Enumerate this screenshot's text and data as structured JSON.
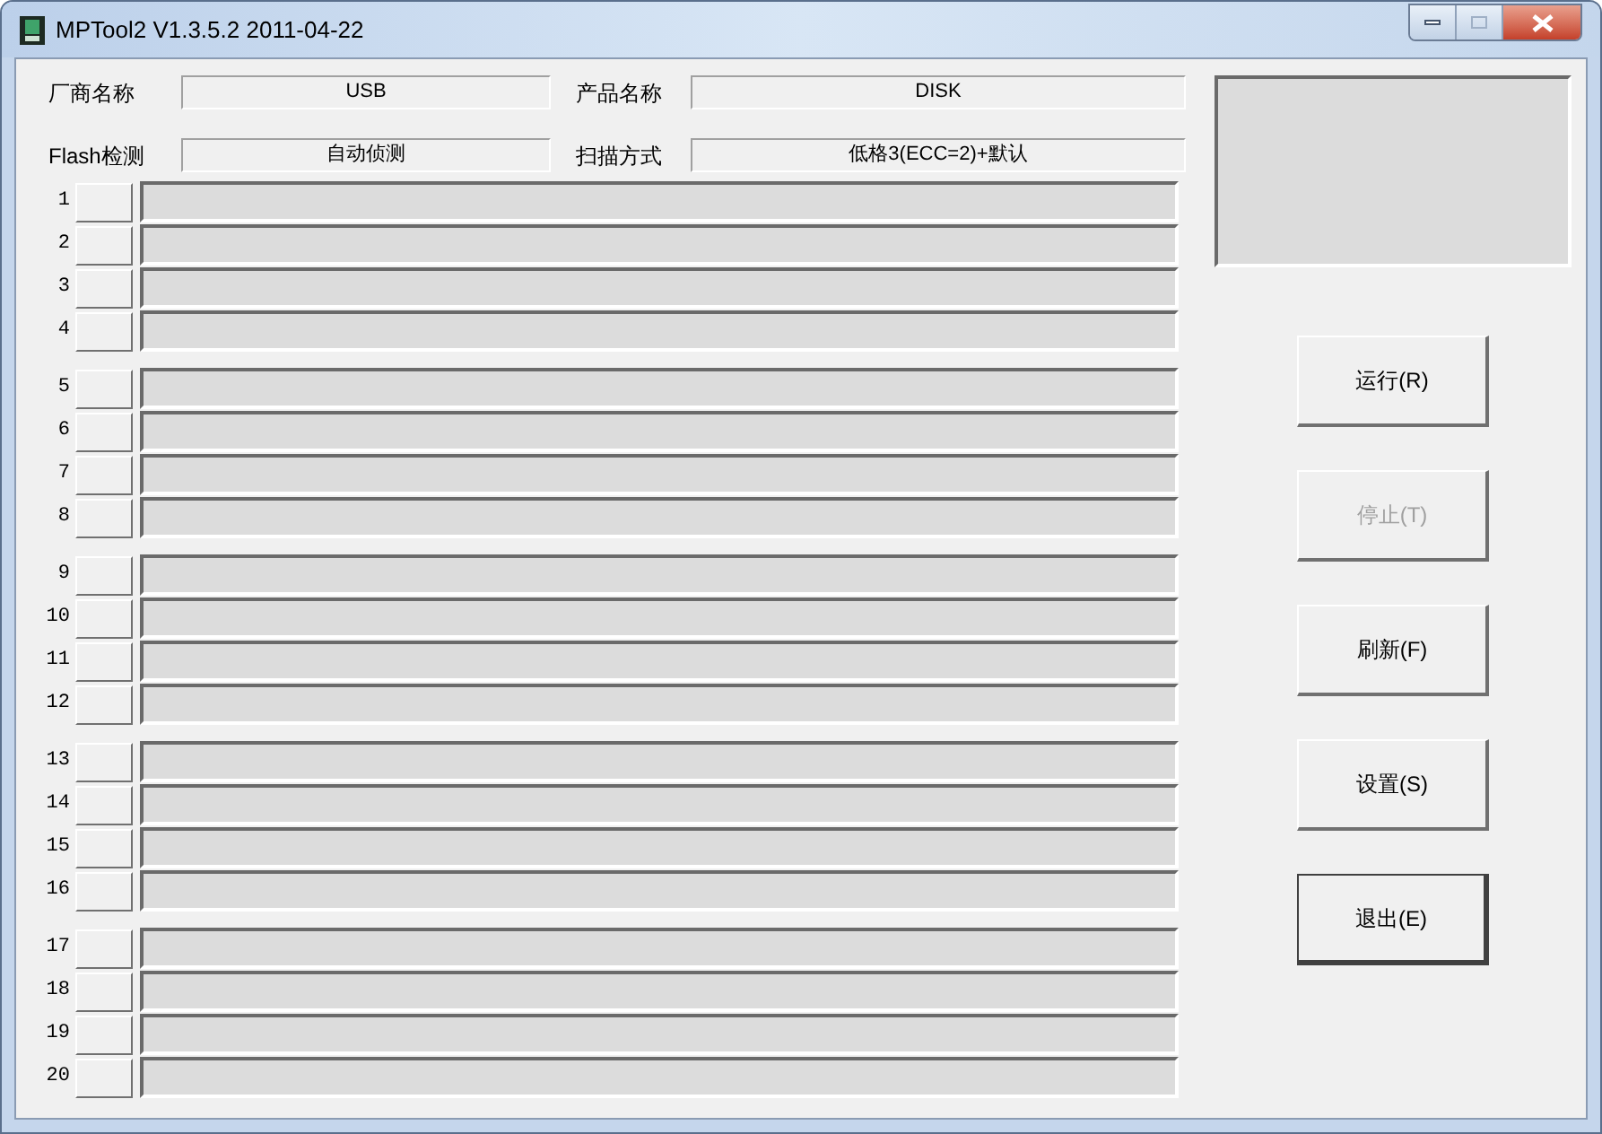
{
  "window": {
    "title": "MPTool2 V1.3.5.2 2011-04-22"
  },
  "fields": [
    {
      "label": "厂商名称",
      "value": "USB"
    },
    {
      "label": "产品名称",
      "value": "DISK"
    },
    {
      "label": "Flash检测",
      "value": "自动侦测"
    },
    {
      "label": "扫描方式",
      "value": "低格3(ECC=2)+默认"
    }
  ],
  "port_groups": [
    {
      "ports": [
        "1",
        "2",
        "3",
        "4"
      ]
    },
    {
      "ports": [
        "5",
        "6",
        "7",
        "8"
      ]
    },
    {
      "ports": [
        "9",
        "10",
        "11",
        "12"
      ]
    },
    {
      "ports": [
        "13",
        "14",
        "15",
        "16"
      ]
    },
    {
      "ports": [
        "17",
        "18",
        "19",
        "20"
      ]
    }
  ],
  "buttons": [
    {
      "label": "运行(R)",
      "disabled": false,
      "default": false
    },
    {
      "label": "停止(T)",
      "disabled": true,
      "default": false
    },
    {
      "label": "刷新(F)",
      "disabled": false,
      "default": false
    },
    {
      "label": "设置(S)",
      "disabled": false,
      "default": false
    },
    {
      "label": "退出(E)",
      "disabled": false,
      "default": true
    }
  ]
}
